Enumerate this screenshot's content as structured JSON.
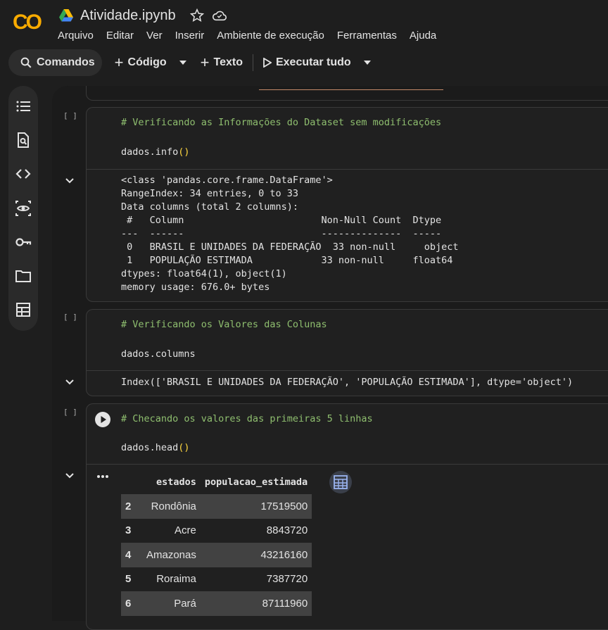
{
  "app": {
    "file_name": "Atividade.ipynb",
    "logo_text": "CO"
  },
  "menu": [
    "Arquivo",
    "Editar",
    "Ver",
    "Inserir",
    "Ambiente de execução",
    "Ferramentas",
    "Ajuda"
  ],
  "toolbar": {
    "commands": "Comandos",
    "code": "Código",
    "text": "Texto",
    "run_all": "Executar tudo"
  },
  "cells": [
    {
      "exec_label": "[ ]",
      "comment": "# Verificando as Informações do Dataset sem modificações",
      "code_name": "dados.info",
      "code_paren": "()",
      "output": "<class 'pandas.core.frame.DataFrame'>\nRangeIndex: 34 entries, 0 to 33\nData columns (total 2 columns):\n #   Column                        Non-Null Count  Dtype  \n---  ------                        --------------  -----  \n 0   BRASIL E UNIDADES DA FEDERAÇÃO  33 non-null     object \n 1   POPULAÇÃO ESTIMADA            33 non-null     float64\ndtypes: float64(1), object(1)\nmemory usage: 676.0+ bytes"
    },
    {
      "exec_label": "[ ]",
      "comment": "# Verificando os Valores das Colunas",
      "code_name": "dados.columns",
      "code_paren": "",
      "output": "Index(['BRASIL E UNIDADES DA FEDERAÇÃO', 'POPULAÇÃO ESTIMADA'], dtype='object')"
    },
    {
      "exec_label": "[ ]",
      "comment": "# Checando os valores das primeiras 5 linhas",
      "code_name": "dados.head",
      "code_paren": "()",
      "output": ""
    }
  ],
  "dataframe": {
    "columns": [
      "estados",
      "populacao_estimada"
    ],
    "rows": [
      {
        "index": "2",
        "estados": "Rondônia",
        "populacao": "17519500"
      },
      {
        "index": "3",
        "estados": "Acre",
        "populacao": "8843720"
      },
      {
        "index": "4",
        "estados": "Amazonas",
        "populacao": "43216160"
      },
      {
        "index": "5",
        "estados": "Roraima",
        "populacao": "7387720"
      },
      {
        "index": "6",
        "estados": "Pará",
        "populacao": "87111960"
      }
    ]
  },
  "colors": {
    "background": "#1e1e1e",
    "comment": "#8fbf6f",
    "paren": "#ffd740",
    "logo_orange": "#f9ab00"
  }
}
